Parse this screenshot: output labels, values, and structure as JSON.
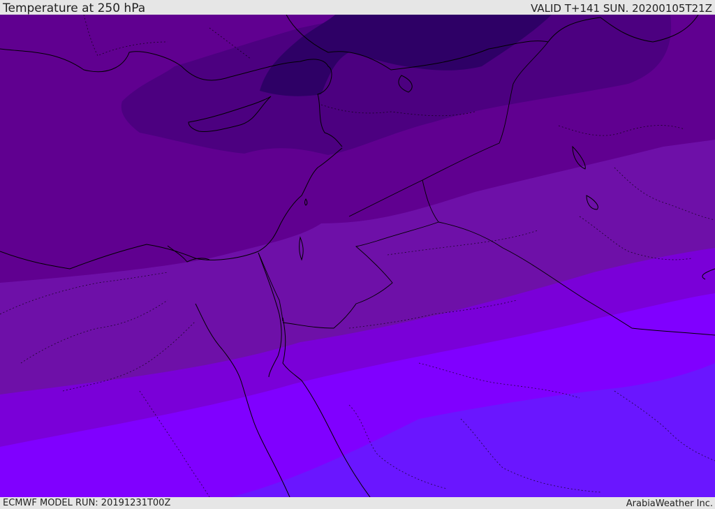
{
  "header": {
    "title": "Temperature at 250 hPa",
    "valid": "VALID T+141 SUN. 20200105T21Z"
  },
  "footer": {
    "model_run": "ECMWF MODEL RUN: 20191231T00Z",
    "credit": "ArabiaWeather Inc."
  },
  "colors": {
    "band_1_coldest": "#2e0066",
    "band_2": "#4c0080",
    "band_3": "#600090",
    "band_4": "#6e10a8",
    "band_5": "#7a00d8",
    "band_6": "#8000ff",
    "band_7_warmest": "#6a16ff",
    "coastline": "#000000",
    "header_bg": "#e6e6e6"
  }
}
